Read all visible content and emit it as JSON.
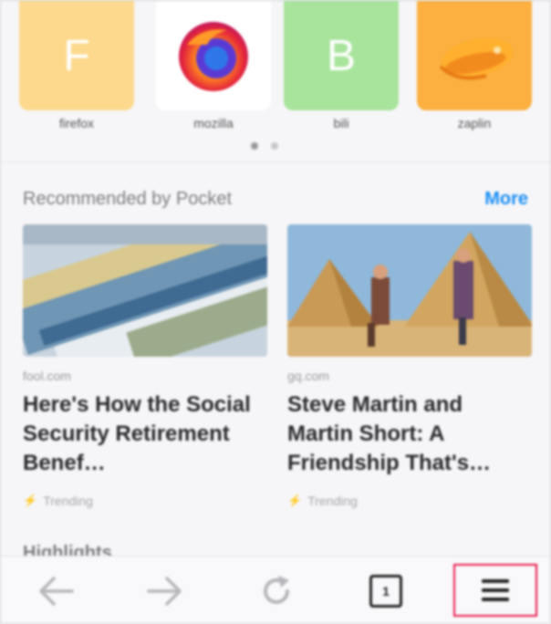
{
  "top_sites": [
    {
      "letter": "F",
      "label": "firefox",
      "color": "#fcd98c",
      "icon": "letter-f-icon"
    },
    {
      "letter": "",
      "label": "mozilla",
      "color": "#ffffff",
      "icon": "firefox-logo-icon"
    },
    {
      "letter": "B",
      "label": "bili",
      "color": "#a8e49c",
      "icon": "letter-b-icon"
    },
    {
      "letter": "",
      "label": "zaplin",
      "color": "#fbb040",
      "icon": "zeplin-logo-icon"
    }
  ],
  "pagination": {
    "pages": 2,
    "current": 1
  },
  "pocket": {
    "title": "Recommended by Pocket",
    "more_label": "More",
    "accent_color": "#1a8ef5",
    "stories": [
      {
        "source": "fool.com",
        "title": "Here's How the Social Security Retirement Benef…",
        "tag": "Trending",
        "image": "social-security-cards-image"
      },
      {
        "source": "gq.com",
        "title": "Steve Martin and Martin Short: A Friendship That's…",
        "tag": "Trending",
        "image": "pyramids-photo-image"
      }
    ]
  },
  "highlights": {
    "title": "Highlights"
  },
  "toolbar": {
    "back_icon": "arrow-left-icon",
    "forward_icon": "arrow-right-icon",
    "reload_icon": "reload-icon",
    "tabs_count": "1",
    "menu_icon": "hamburger-menu-icon",
    "highlight_color": "#e8174a"
  }
}
